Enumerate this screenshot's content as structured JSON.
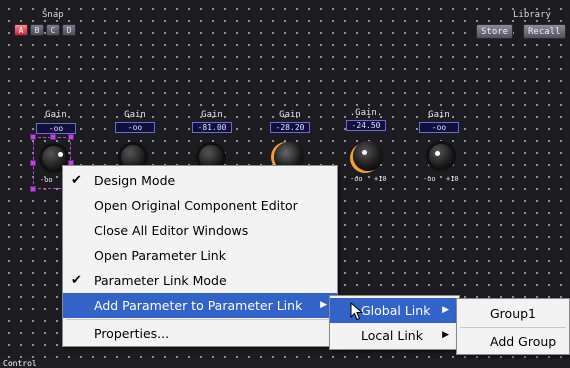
{
  "header": {
    "snap_label": "Snap",
    "snap_buttons": [
      "A",
      "B",
      "C",
      "D"
    ],
    "library_label": "Library",
    "store_label": "Store",
    "recall_label": "Recall"
  },
  "gains": [
    {
      "label": "Gain",
      "value": "-oo"
    },
    {
      "label": "Gain",
      "value": "-oo"
    },
    {
      "label": "Gain",
      "value": "-81.00"
    },
    {
      "label": "Gain",
      "value": "-28.20"
    },
    {
      "label": ".Gain.",
      "value": "-24.50"
    },
    {
      "label": "Gain",
      "value": "-oo"
    }
  ],
  "knob_scale": {
    "min": "-oo",
    "max": "+10"
  },
  "context_menu": {
    "items": [
      {
        "label": "Design Mode",
        "checked": true
      },
      {
        "label": "Open Original Component Editor"
      },
      {
        "label": "Close All Editor Windows"
      },
      {
        "label": "Open Parameter Link"
      },
      {
        "label": "Parameter Link Mode",
        "checked": true
      },
      {
        "label": "Add Parameter to Parameter Link",
        "submenu": true,
        "highlighted": true
      },
      {
        "label": "Properties..."
      }
    ],
    "check_glyph": "✔",
    "arrow_glyph": "▶"
  },
  "link_submenu": {
    "items": [
      {
        "label": "Global Link",
        "submenu": true,
        "highlighted": true
      },
      {
        "label": "Local Link",
        "submenu": true
      }
    ]
  },
  "group_submenu": {
    "items": [
      {
        "label": "Group1"
      },
      {
        "label": "Add Group"
      }
    ]
  },
  "status": {
    "text": "Control"
  },
  "colors": {
    "highlight": "#3263c8",
    "active_snap": "#d61c3a",
    "selection": "#b64ad8",
    "knob_accent": "#f0a030"
  }
}
